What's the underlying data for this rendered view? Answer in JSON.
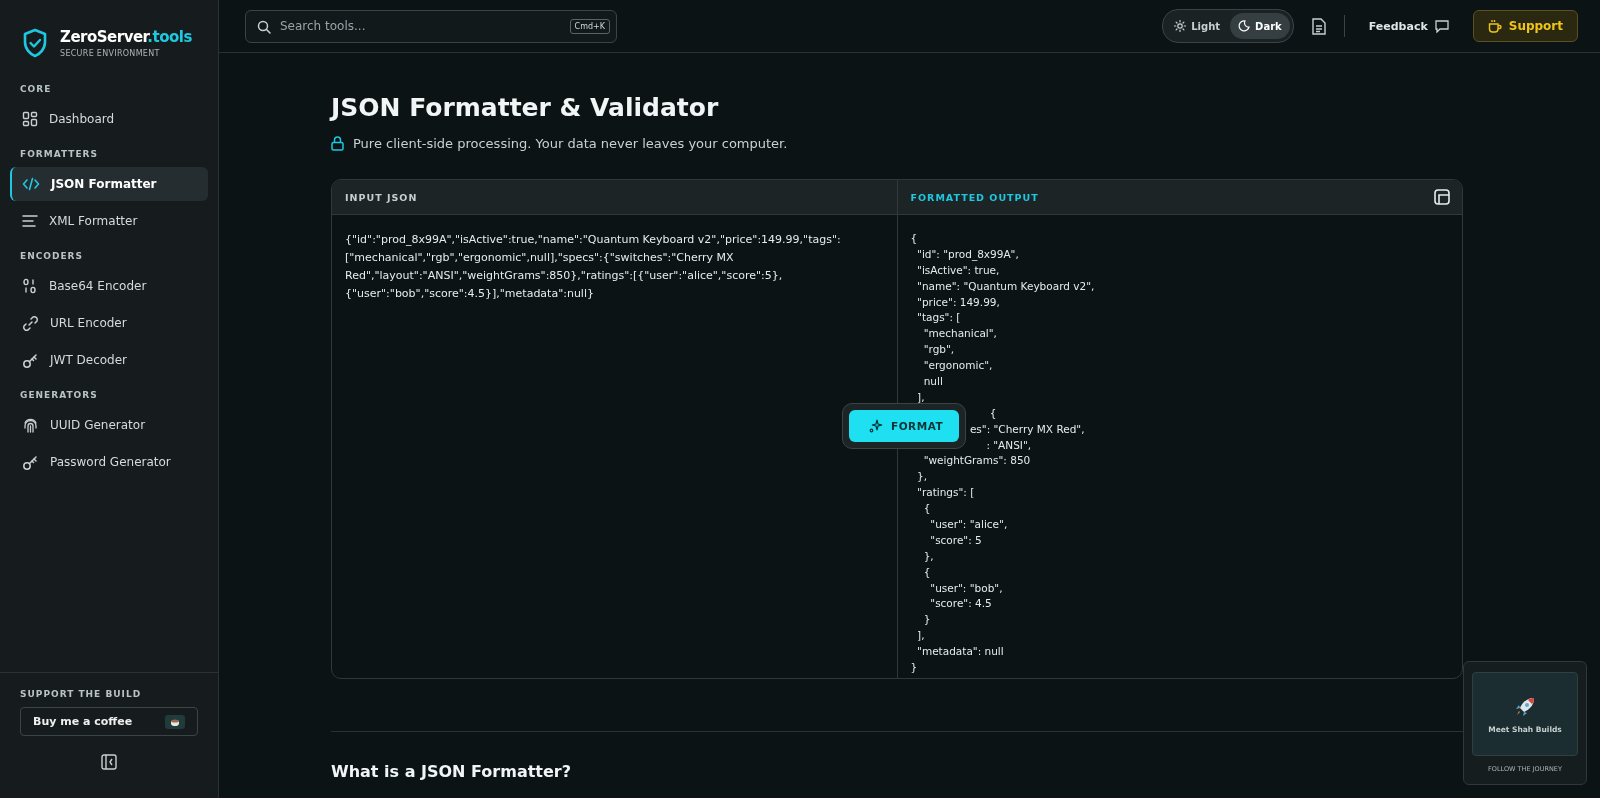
{
  "brand": {
    "name": "ZeroServer",
    "suffix": ".tools",
    "tagline": "SECURE ENVIRONMENT"
  },
  "sidebar": {
    "sections": [
      {
        "title": "CORE",
        "items": [
          {
            "label": "Dashboard",
            "selected": false
          }
        ]
      },
      {
        "title": "FORMATTERS",
        "items": [
          {
            "label": "JSON Formatter",
            "selected": true
          },
          {
            "label": "XML Formatter",
            "selected": false
          }
        ]
      },
      {
        "title": "ENCODERS",
        "items": [
          {
            "label": "Base64 Encoder",
            "selected": false
          },
          {
            "label": "URL Encoder",
            "selected": false
          },
          {
            "label": "JWT Decoder",
            "selected": false
          }
        ]
      },
      {
        "title": "GENERATORS",
        "items": [
          {
            "label": "UUID Generator",
            "selected": false
          },
          {
            "label": "Password Generator",
            "selected": false
          }
        ]
      }
    ],
    "support": {
      "title": "SUPPORT THE BUILD",
      "button": "Buy me a coffee"
    }
  },
  "topbar": {
    "search": {
      "placeholder": "Search tools...",
      "shortcut": "Cmd+K"
    },
    "theme": [
      {
        "label": "Light",
        "selected": false
      },
      {
        "label": "Dark",
        "selected": true
      }
    ],
    "feedback": "Feedback",
    "support": "Support"
  },
  "page": {
    "title": "JSON Formatter & Validator",
    "subtitle": "Pure client-side processing. Your data never leaves your computer.",
    "input": {
      "header": "INPUT JSON",
      "value": "{\"id\":\"prod_8x99A\",\"isActive\":true,\"name\":\"Quantum Keyboard v2\",\"price\":149.99,\"tags\":[\"mechanical\",\"rgb\",\"ergonomic\",null],\"specs\":{\"switches\":\"Cherry MX Red\",\"layout\":\"ANSI\",\"weightGrams\":850},\"ratings\":[{\"user\":\"alice\",\"score\":5},{\"user\":\"bob\",\"score\":4.5}],\"metadata\":null}"
    },
    "output": {
      "header": "FORMATTED OUTPUT",
      "lines": [
        "{",
        "  \"id\": \"prod_8x99A\",",
        "  \"isActive\": true,",
        "  \"name\": \"Quantum Keyboard v2\",",
        "  \"price\": 149.99,",
        "  \"tags\": [",
        "    \"mechanical\",",
        "    \"rgb\",",
        "    \"ergonomic\",",
        "    null",
        "  ],",
        "                        {",
        "                  es\": \"Cherry MX Red\",",
        "                       : \"ANSI\",",
        "    \"weightGrams\": 850",
        "  },",
        "  \"ratings\": [",
        "    {",
        "      \"user\": \"alice\",",
        "      \"score\": 5",
        "    },",
        "    {",
        "      \"user\": \"bob\",",
        "      \"score\": 4.5",
        "    }",
        "  ],",
        "  \"metadata\": null",
        "}"
      ]
    },
    "format_button": "FORMAT",
    "section_heading": "What is a JSON Formatter?"
  },
  "promo": {
    "title": "Meet Shah Builds",
    "caption": "FOLLOW THE JOURNEY"
  }
}
